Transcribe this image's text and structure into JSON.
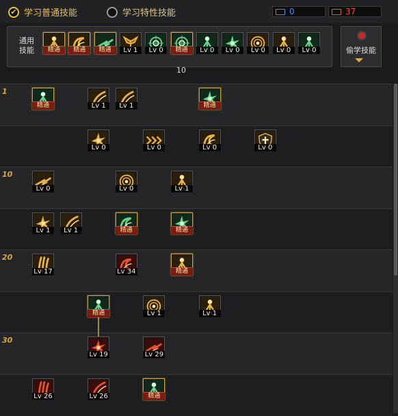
{
  "header": {
    "learn_normal": "学习普通技能",
    "learn_trait": "学习特性技能",
    "sp_value": "0",
    "tp_value": "37",
    "colors": {
      "accent": "#e8c24a",
      "sp": "#3b8ff0",
      "tp": "#f0503c"
    }
  },
  "common": {
    "label": "通用技能",
    "skills": [
      {
        "badge": "精通",
        "theme": "gold",
        "glyph": "figure"
      },
      {
        "badge": "精通",
        "theme": "gold",
        "glyph": "swirl"
      },
      {
        "badge": "精通",
        "theme": "green",
        "glyph": "dash"
      },
      {
        "badge": "Lv 1",
        "theme": "gold",
        "glyph": "wings"
      },
      {
        "badge": "Lv 0",
        "theme": "green",
        "glyph": "target"
      },
      {
        "badge": "精通",
        "theme": "green",
        "glyph": "target"
      },
      {
        "badge": "Lv 0",
        "theme": "green",
        "glyph": "figure"
      },
      {
        "badge": "Lv 0",
        "theme": "green",
        "glyph": "burst"
      },
      {
        "badge": "Lv 0",
        "theme": "gold",
        "glyph": "rings"
      },
      {
        "badge": "Lv 0",
        "theme": "gold",
        "glyph": "figure"
      },
      {
        "badge": "Lv 0",
        "theme": "green",
        "glyph": "figure"
      }
    ],
    "note": "10",
    "steal_label": "偷学技能"
  },
  "tree": {
    "row_labels": [
      "1",
      "",
      "10",
      "",
      "20",
      "",
      "30",
      ""
    ],
    "skills": [
      {
        "row": 0,
        "col": 0,
        "badge": "精通",
        "theme": "green",
        "glyph": "figure"
      },
      {
        "row": 0,
        "col": 2,
        "badge": "Lv 1",
        "theme": "gold",
        "glyph": "slash"
      },
      {
        "row": 0,
        "col": 3,
        "badge": "Lv 1",
        "theme": "gold",
        "glyph": "slash"
      },
      {
        "row": 0,
        "col": 6,
        "badge": "精通",
        "theme": "green",
        "glyph": "burst"
      },
      {
        "row": 1,
        "col": 2,
        "badge": "Lv 0",
        "theme": "gold",
        "glyph": "burst"
      },
      {
        "row": 1,
        "col": 4,
        "badge": "Lv 0",
        "theme": "gold",
        "glyph": "arrows"
      },
      {
        "row": 1,
        "col": 6,
        "badge": "Lv 0",
        "theme": "gold",
        "glyph": "swirl"
      },
      {
        "row": 1,
        "col": 8,
        "badge": "Lv 0",
        "theme": "gold",
        "glyph": "shield"
      },
      {
        "row": 2,
        "col": 0,
        "badge": "Lv 0",
        "theme": "gold",
        "glyph": "dash"
      },
      {
        "row": 2,
        "col": 3,
        "badge": "Lv 0",
        "theme": "gold",
        "glyph": "rings"
      },
      {
        "row": 2,
        "col": 5,
        "badge": "Lv 1",
        "theme": "gold",
        "glyph": "figure"
      },
      {
        "row": 3,
        "col": 0,
        "badge": "Lv 1",
        "theme": "gold",
        "glyph": "burst"
      },
      {
        "row": 3,
        "col": 1,
        "badge": "Lv 1",
        "theme": "gold",
        "glyph": "slash"
      },
      {
        "row": 3,
        "col": 3,
        "badge": "精通",
        "theme": "green",
        "glyph": "swirl"
      },
      {
        "row": 3,
        "col": 5,
        "badge": "精通",
        "theme": "green",
        "glyph": "burst"
      },
      {
        "row": 4,
        "col": 0,
        "badge": "Lv 17",
        "theme": "gold",
        "glyph": "claw"
      },
      {
        "row": 4,
        "col": 3,
        "badge": "Lv 34",
        "theme": "red",
        "glyph": "swirl"
      },
      {
        "row": 4,
        "col": 5,
        "badge": "精通",
        "theme": "gold",
        "glyph": "figure"
      },
      {
        "row": 5,
        "col": 2,
        "badge": "精通",
        "theme": "green",
        "glyph": "figure"
      },
      {
        "row": 5,
        "col": 4,
        "badge": "Lv 1",
        "theme": "gold",
        "glyph": "rings"
      },
      {
        "row": 5,
        "col": 6,
        "badge": "Lv 1",
        "theme": "gold",
        "glyph": "figure"
      },
      {
        "row": 6,
        "col": 2,
        "badge": "Lv 19",
        "theme": "red",
        "glyph": "burst"
      },
      {
        "row": 6,
        "col": 4,
        "badge": "Lv 29",
        "theme": "red",
        "glyph": "dash"
      },
      {
        "row": 7,
        "col": 0,
        "badge": "Lv 26",
        "theme": "red",
        "glyph": "claw"
      },
      {
        "row": 7,
        "col": 2,
        "badge": "Lv 26",
        "theme": "red",
        "glyph": "slash"
      },
      {
        "row": 7,
        "col": 4,
        "badge": "精通",
        "theme": "green",
        "glyph": "figure"
      }
    ]
  }
}
